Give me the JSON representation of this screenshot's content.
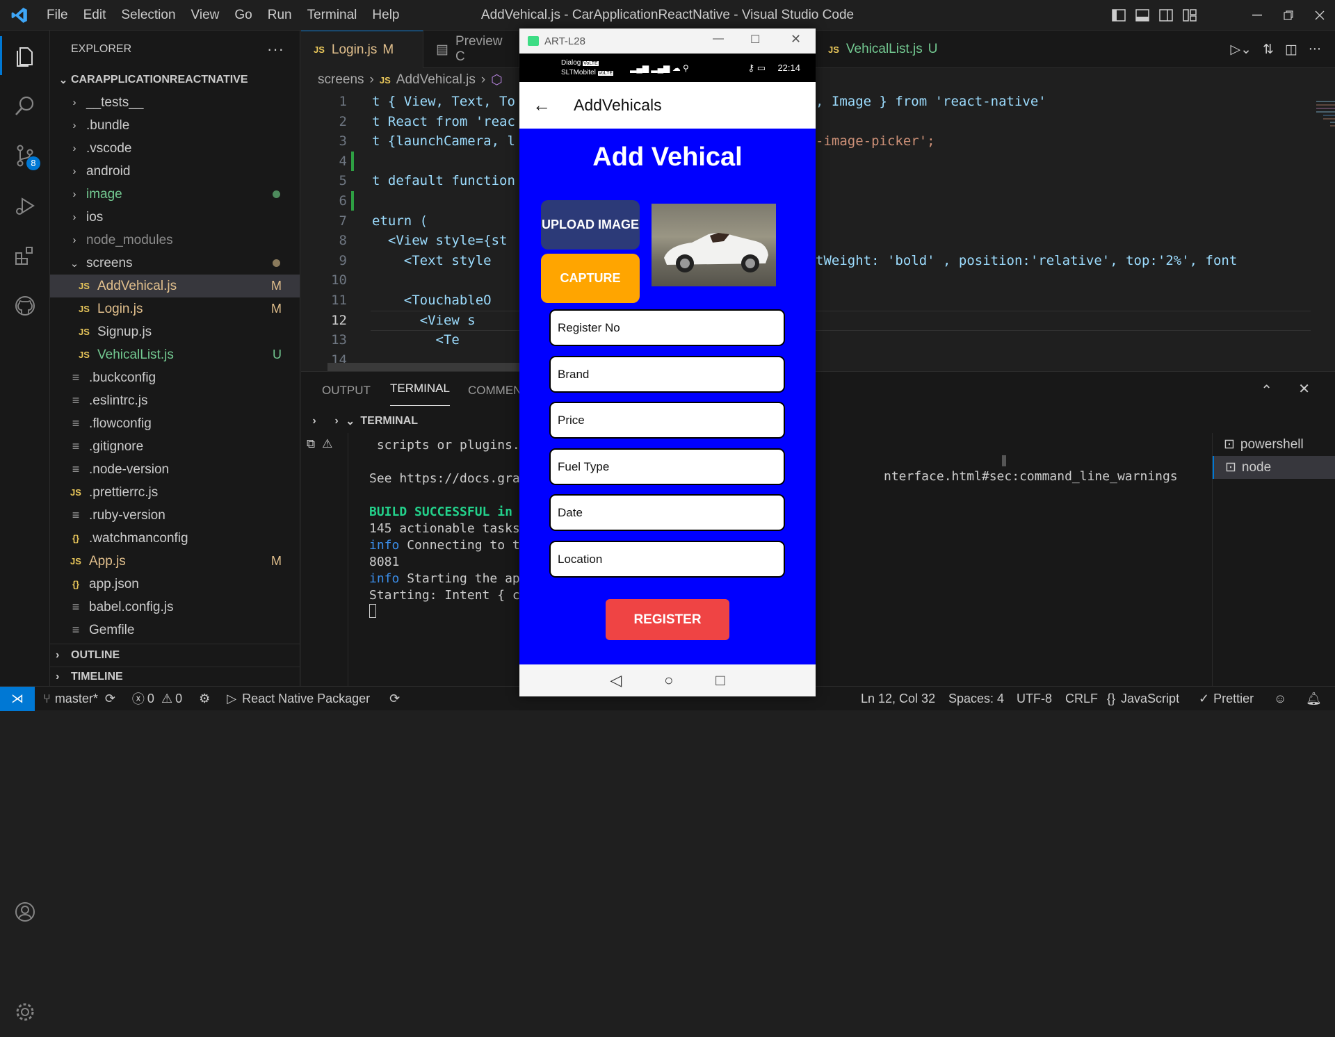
{
  "titlebar": {
    "menu": [
      "File",
      "Edit",
      "Selection",
      "View",
      "Go",
      "Run",
      "Terminal",
      "Help"
    ],
    "window_title": "AddVehical.js - CarApplicationReactNative - Visual Studio Code"
  },
  "activity": {
    "source_control_badge": "8"
  },
  "explorer": {
    "header": "EXPLORER",
    "project": "CARAPPLICATIONREACTNATIVE",
    "items": [
      {
        "label": "__tests__",
        "kind": "folder"
      },
      {
        "label": ".bundle",
        "kind": "folder"
      },
      {
        "label": ".vscode",
        "kind": "folder"
      },
      {
        "label": "android",
        "kind": "folder"
      },
      {
        "label": "image",
        "kind": "folder"
      },
      {
        "label": "ios",
        "kind": "folder"
      },
      {
        "label": "node_modules",
        "kind": "folder"
      },
      {
        "label": "screens",
        "kind": "folder"
      },
      {
        "label": "AddVehical.js",
        "kind": "js",
        "badge": "M"
      },
      {
        "label": "Login.js",
        "kind": "js",
        "badge": "M"
      },
      {
        "label": "Signup.js",
        "kind": "js"
      },
      {
        "label": "VehicalList.js",
        "kind": "js",
        "badge": "U"
      },
      {
        "label": ".buckconfig",
        "kind": "file"
      },
      {
        "label": ".eslintrc.js",
        "kind": "file"
      },
      {
        "label": ".flowconfig",
        "kind": "file"
      },
      {
        "label": ".gitignore",
        "kind": "file"
      },
      {
        "label": ".node-version",
        "kind": "file"
      },
      {
        "label": ".prettierrc.js",
        "kind": "js"
      },
      {
        "label": ".ruby-version",
        "kind": "file"
      },
      {
        "label": ".watchmanconfig",
        "kind": "json"
      },
      {
        "label": "App.js",
        "kind": "js",
        "badge": "M"
      },
      {
        "label": "app.json",
        "kind": "json"
      },
      {
        "label": "babel.config.js",
        "kind": "file"
      },
      {
        "label": "Gemfile",
        "kind": "file"
      }
    ],
    "outline": "OUTLINE",
    "timeline": "TIMELINE"
  },
  "tabs": [
    {
      "label": "Login.js",
      "badge": "M"
    },
    {
      "label": "Preview C"
    },
    {
      "label": "VehicalList.js",
      "badge": "U"
    }
  ],
  "breadcrumbs": {
    "folder": "screens",
    "file": "AddVehical.js"
  },
  "editor": {
    "line_numbers": [
      "1",
      "2",
      "3",
      "4",
      "5",
      "6",
      "7",
      "8",
      "9",
      "10",
      "11",
      "12",
      "13",
      "14"
    ],
    "left_lines": [
      "t { View, Text, To",
      "t React from 'reac",
      "t {launchCamera, l",
      "",
      "t default function",
      "",
      "eturn (",
      "  <View style={st",
      "    <Text style",
      "",
      "    <TouchableO",
      "      <View s",
      "        <Te",
      ""
    ],
    "right_lines": [
      ", Image } from 'react-native'",
      "",
      "-image-picker';",
      "",
      "",
      "",
      "",
      "",
      "tWeight: 'bold' , position:'relative', top:'2%', font",
      "",
      "",
      "",
      "",
      ""
    ]
  },
  "panel": {
    "tabs": [
      "OUTPUT",
      "TERMINAL",
      "COMMEN"
    ],
    "section": "TERMINAL",
    "terminal_left": [
      {
        "text": " scripts or plugins.",
        "cls": ""
      },
      {
        "text": "",
        "cls": ""
      },
      {
        "text": "See https://docs.gra",
        "cls": ""
      },
      {
        "text": "",
        "cls": ""
      },
      {
        "text": "BUILD SUCCESSFUL in ",
        "cls": "build"
      },
      {
        "text": "145 actionable tasks",
        "cls": ""
      },
      {
        "text": "info Connecting to t",
        "cls": "info"
      },
      {
        "text": "8081",
        "cls": ""
      },
      {
        "text": "info Starting the ap",
        "cls": "info"
      },
      {
        "text": "Starting: Intent { c",
        "cls": ""
      }
    ],
    "terminal_right_line": "nterface.html#sec:command_line_warnings",
    "shells": [
      "powershell",
      "node"
    ]
  },
  "statusbar": {
    "branch": "master*",
    "errors": "0",
    "warnings": "0",
    "packager": "React Native Packager",
    "position": "Ln 12, Col 32",
    "spaces": "Spaces: 4",
    "encoding": "UTF-8",
    "eol": "CRLF",
    "language": "JavaScript",
    "prettier": "Prettier"
  },
  "emulator": {
    "window_title": "ART-L28",
    "carrier1": "Dialog",
    "carrier2": "SLTMobitel",
    "volte": "VoLTE",
    "time": "22:14",
    "app_title": "AddVehicals",
    "heading": "Add Vehical",
    "upload_label": "UPLOAD IMAGE",
    "capture_label": "CAPTURE",
    "fields": [
      "Register No",
      "Brand",
      "Price",
      "Fuel Type",
      "Date",
      "Location"
    ],
    "register_label": "REGISTER"
  },
  "colors": {
    "accent": "#0078d4",
    "app_bg": "#0000ff",
    "capture": "#ffa500",
    "upload": "#2c3a78",
    "register": "#ef4444",
    "modified": "#e2c08d",
    "untracked": "#73c991"
  }
}
